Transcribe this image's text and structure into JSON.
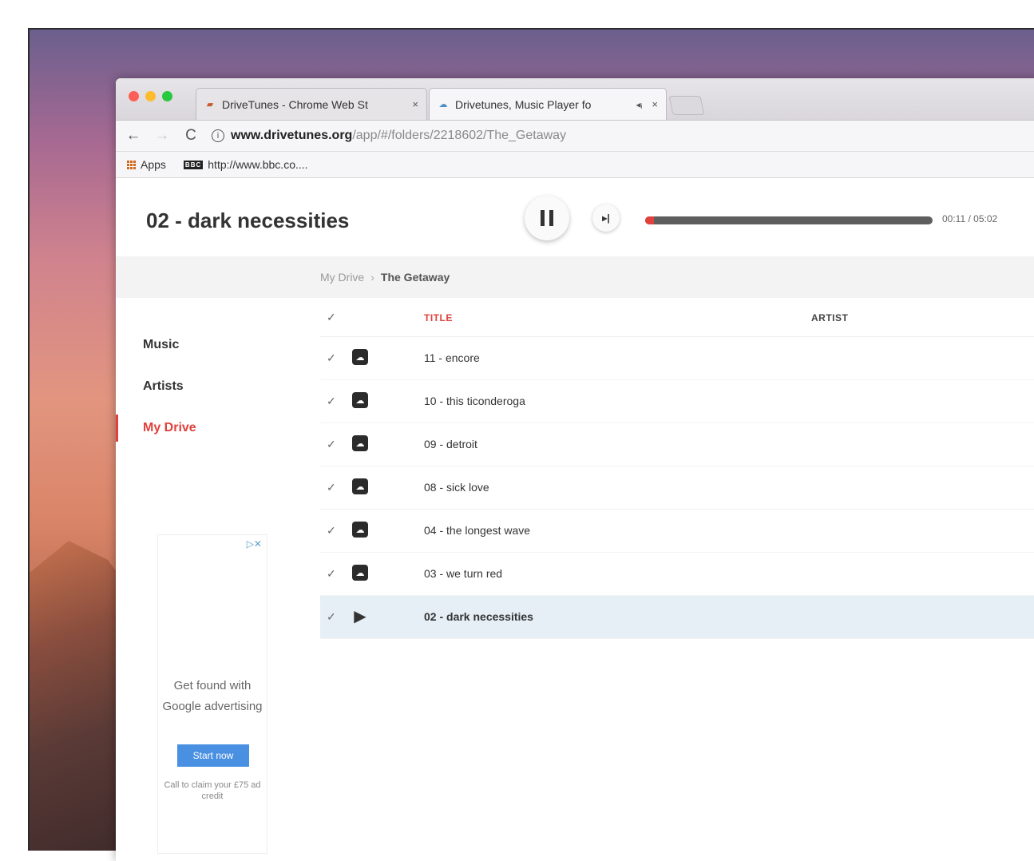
{
  "browser": {
    "tabs": [
      {
        "label": "DriveTunes - Chrome Web St",
        "close": "×"
      },
      {
        "label": "Drivetunes, Music Player fo",
        "audio": "◂ᵢ",
        "close": "×"
      }
    ],
    "address": {
      "domain": "www.drivetunes.org",
      "path": "/app/#/folders/2218602/The_Getaway"
    },
    "bookmarks": [
      {
        "label": "Apps"
      },
      {
        "label": "http://www.bbc.co....",
        "icon_text": "BBC"
      }
    ]
  },
  "player": {
    "now_playing": "02 - dark necessities",
    "time": "00:11 / 05:02",
    "progress": 0.03,
    "accent_color": "#e0413c"
  },
  "breadcrumb": {
    "root": "My Drive",
    "separator": "›",
    "current": "The Getaway"
  },
  "sidebar": {
    "items": [
      {
        "label": "Music"
      },
      {
        "label": "Artists"
      },
      {
        "label": "My Drive",
        "active": true
      }
    ]
  },
  "ad": {
    "text": "Get found with Google advertising",
    "button": "Start now",
    "small": "Call to claim your £75 ad credit"
  },
  "table": {
    "columns": {
      "title": "TITLE",
      "artist": "ARTIST"
    },
    "rows": [
      {
        "title": "11 - encore",
        "icon": "cloud-icon"
      },
      {
        "title": "10 - this ticonderoga",
        "icon": "cloud-icon"
      },
      {
        "title": "09 - detroit",
        "icon": "cloud-icon"
      },
      {
        "title": "08 - sick love",
        "icon": "cloud-icon"
      },
      {
        "title": "04 - the longest wave",
        "icon": "cloud-icon"
      },
      {
        "title": "03 - we turn red",
        "icon": "cloud-icon"
      },
      {
        "title": "02 - dark necessities",
        "icon": "play-icon",
        "playing": true
      }
    ]
  }
}
